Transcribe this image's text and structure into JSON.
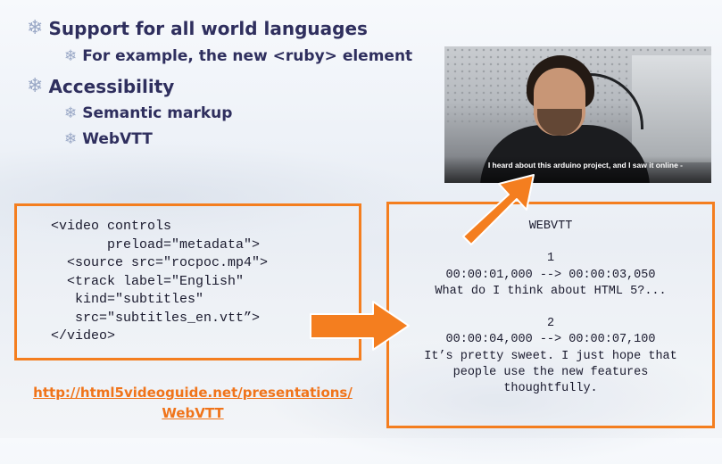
{
  "slide": {
    "bullets": {
      "b1": "Support for all world languages",
      "b1_1": "For example, the new <ruby> element",
      "b2": "Accessibility",
      "b2_1": "Semantic markup",
      "b2_2": "WebVTT"
    },
    "bullet_icon": "snowflake-icon",
    "video": {
      "subtitle": "I heard about this arduino project, and I saw it online -"
    },
    "code_example": "<video controls\n       preload=\"metadata\">\n  <source src=\"rocpoc.mp4\">\n  <track label=\"English\"\n   kind=\"subtitles\"\n   src=\"subtitles_en.vtt”>\n</video>",
    "vtt_example": "WEBVTT\n\n1\n00:00:01,000 --> 00:00:03,050\nWhat do I think about HTML 5?...\n\n2\n00:00:04,000 --> 00:00:07,100\nIt’s pretty sweet. I just hope that\npeople use the new features\nthoughtfully.",
    "link": {
      "line1": "http://html5videoguide.net/presentations/",
      "line2": "WebVTT"
    },
    "colors": {
      "accent": "#f47e1f",
      "heading": "#2f2f5e",
      "link": "#f0741a"
    }
  }
}
